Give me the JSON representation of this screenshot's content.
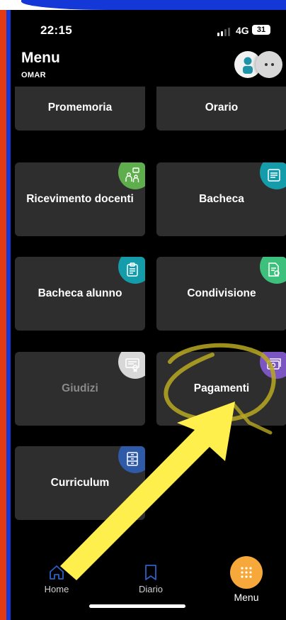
{
  "status_bar": {
    "time": "22:15",
    "network": "4G",
    "battery": "31"
  },
  "header": {
    "title": "Menu",
    "user": "OMAR"
  },
  "tiles": [
    {
      "label": "Promemoria",
      "icon": "bell-icon",
      "color": ""
    },
    {
      "label": "Orario",
      "icon": "clock-icon",
      "color": ""
    },
    {
      "label": "Ricevimento docenti",
      "icon": "meeting-icon",
      "color": "#5fae4e"
    },
    {
      "label": "Bacheca",
      "icon": "noticeboard-icon",
      "color": "#149cab"
    },
    {
      "label": "Bacheca alunno",
      "icon": "clipboard-icon",
      "color": "#149cab"
    },
    {
      "label": "Condivisione",
      "icon": "share-document-icon",
      "color": "#3cc07c"
    },
    {
      "label": "Giudizi",
      "icon": "certificate-icon",
      "color": "#d8d8d8"
    },
    {
      "label": "Pagamenti",
      "icon": "payment-icon",
      "color": "#7b55c2"
    },
    {
      "label": "Curriculum",
      "icon": "cabinet-icon",
      "color": "#2f5aa8"
    }
  ],
  "nav": {
    "home": "Home",
    "diario": "Diario",
    "menu": "Menu",
    "menu_color": "#f6a83a"
  },
  "annotation": {
    "arrow_color": "#ffef4d",
    "circle_color": "#b8a820"
  }
}
